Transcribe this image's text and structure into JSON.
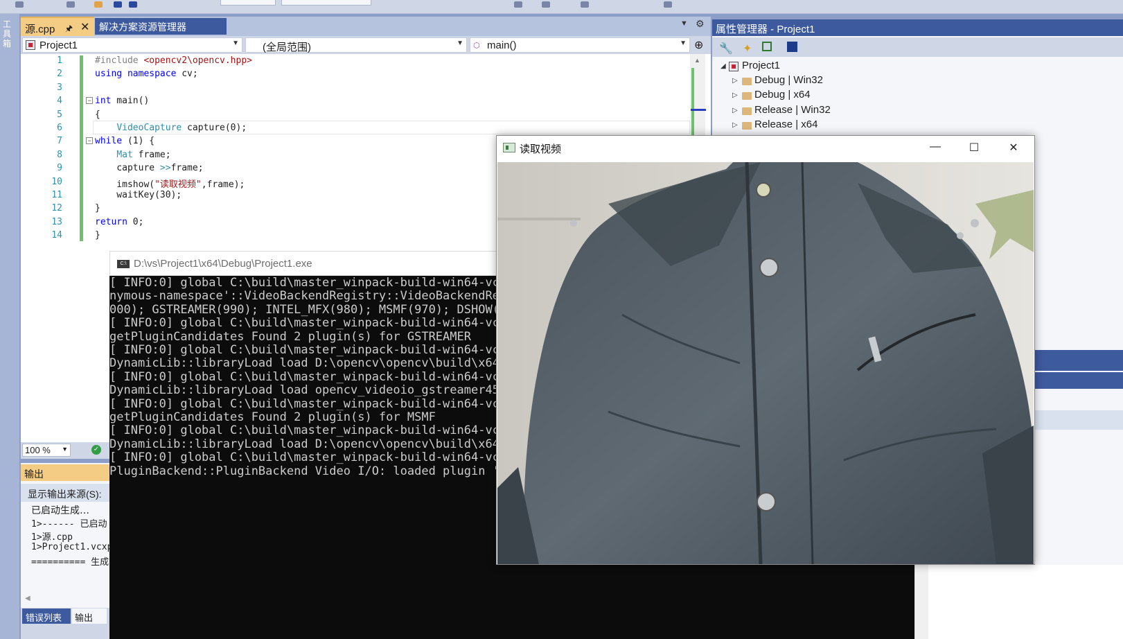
{
  "toolbox": {
    "label": "工具箱"
  },
  "editor": {
    "tabs": {
      "active_file": "源.cpp",
      "pin_icon": "pin-icon",
      "close_glyph": "✕",
      "solution_explorer": "解决方案资源管理器"
    },
    "nav": {
      "project": "Project1",
      "scope": "(全局范围)",
      "member": "main()"
    },
    "lines": [
      {
        "n": "1",
        "parts": [
          {
            "c": "pp",
            "t": "#include "
          },
          {
            "c": "str",
            "t": "<opencv2\\opencv.hpp>"
          }
        ]
      },
      {
        "n": "2",
        "parts": [
          {
            "c": "kw",
            "t": "using namespace"
          },
          {
            "c": "",
            "t": " cv;"
          }
        ]
      },
      {
        "n": "3",
        "parts": []
      },
      {
        "n": "4",
        "parts": [
          {
            "c": "kw",
            "t": "int"
          },
          {
            "c": "",
            "t": " main()"
          }
        ]
      },
      {
        "n": "5",
        "parts": [
          {
            "c": "",
            "t": "{"
          }
        ]
      },
      {
        "n": "6",
        "parts": [
          {
            "c": "",
            "t": "    "
          },
          {
            "c": "ty",
            "t": "VideoCapture"
          },
          {
            "c": "",
            "t": " capture(0);"
          }
        ]
      },
      {
        "n": "7",
        "parts": [
          {
            "c": "kw",
            "t": "while"
          },
          {
            "c": "",
            "t": " (1) {"
          }
        ]
      },
      {
        "n": "8",
        "parts": [
          {
            "c": "",
            "t": "    "
          },
          {
            "c": "ty",
            "t": "Mat"
          },
          {
            "c": "",
            "t": " frame;"
          }
        ]
      },
      {
        "n": "9",
        "parts": [
          {
            "c": "",
            "t": "    capture "
          },
          {
            "c": "ty",
            "t": ">>"
          },
          {
            "c": "",
            "t": "frame;"
          }
        ]
      },
      {
        "n": "10",
        "parts": [
          {
            "c": "",
            "t": "    imshow("
          },
          {
            "c": "str",
            "t": "\"读取视频\""
          },
          {
            "c": "",
            "t": ",frame);"
          }
        ]
      },
      {
        "n": "11",
        "parts": [
          {
            "c": "",
            "t": "    waitKey(30);"
          }
        ]
      },
      {
        "n": "12",
        "parts": [
          {
            "c": "",
            "t": "}"
          }
        ]
      },
      {
        "n": "13",
        "parts": [
          {
            "c": "kw",
            "t": "return"
          },
          {
            "c": "",
            "t": " 0;"
          }
        ]
      },
      {
        "n": "14",
        "parts": [
          {
            "c": "",
            "t": "}"
          }
        ]
      }
    ],
    "zoom": "100 %"
  },
  "output": {
    "title": "输出",
    "source_label": "显示输出来源(S):",
    "lines": [
      "已启动生成…",
      "1>------ 已启动",
      "1>源.cpp",
      "1>Project1.vcxp",
      "========== 生成"
    ],
    "tabs": {
      "error_list": "错误列表",
      "output": "输出"
    }
  },
  "property_manager": {
    "title": "属性管理器 - Project1",
    "root": "Project1",
    "configs": [
      "Debug | Win32",
      "Debug | x64",
      "Release | Win32",
      "Release | x64"
    ]
  },
  "console": {
    "title": "D:\\vs\\Project1\\x64\\Debug\\Project1.exe",
    "lines": [
      "[ INFO:0] global C:\\build\\master_winpack-build-win64-vc14\\",
      "nymous-namespace'::VideoBackendRegistry::VideoBackendRegis",
      "000); GSTREAMER(990); INTEL_MFX(980); MSMF(970); DSHOW(960",
      "[ INFO:0] global C:\\build\\master_winpack-build-win64-vc14\\",
      "getPluginCandidates Found 2 plugin(s) for GSTREAMER",
      "[ INFO:0] global C:\\build\\master_winpack-build-win64-vc14\\",
      "DynamicLib::libraryLoad load D:\\opencv\\opencv\\build\\x64\\vc",
      "[ INFO:0] global C:\\build\\master_winpack-build-win64-vc14\\",
      "DynamicLib::libraryLoad load opencv_videoio_gstreamer450_6",
      "[ INFO:0] global C:\\build\\master_winpack-build-win64-vc14\\",
      "getPluginCandidates Found 2 plugin(s) for MSMF",
      "[ INFO:0] global C:\\build\\master_winpack-build-win64-vc14\\",
      "DynamicLib::libraryLoad load D:\\opencv\\opencv\\build\\x64\\vc",
      "[ INFO:0] global C:\\build\\master_winpack-build-win64-vc14\\",
      "PluginBackend::PluginBackend Video I/O: loaded plugin 'Mic"
    ]
  },
  "video_window": {
    "title": "读取视频",
    "minimize_glyph": "—",
    "maximize_glyph": "☐",
    "close_glyph": "✕"
  },
  "colors": {
    "accent": "#3e5a9e",
    "active_tab": "#f5cc84",
    "chrome": "#cfd6e5",
    "console_bg": "#0c0c0c"
  }
}
